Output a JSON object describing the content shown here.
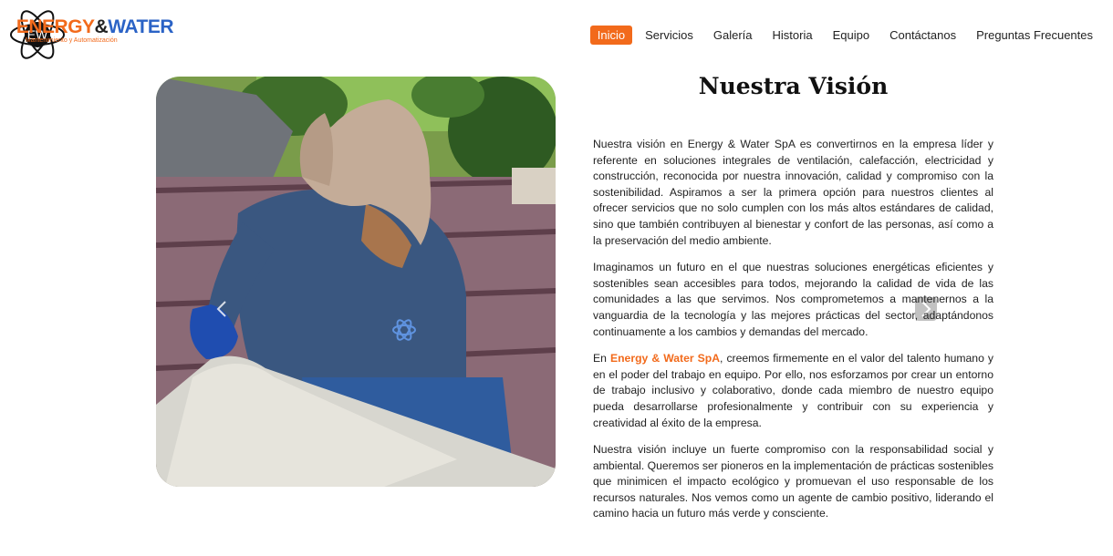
{
  "logo": {
    "mark_text": "EW",
    "word_energy": "ENERGY",
    "word_amp": "&",
    "word_water": "WATER",
    "tagline": "Mantenimiento y Automatización",
    "colors": {
      "orange": "#f26a1b",
      "blue": "#2b63c6"
    }
  },
  "nav": {
    "items": [
      {
        "label": "Inicio",
        "active": true
      },
      {
        "label": "Servicios"
      },
      {
        "label": "Galería"
      },
      {
        "label": "Historia"
      },
      {
        "label": "Equipo"
      },
      {
        "label": "Contáctanos"
      },
      {
        "label": "Preguntas Frecuentes"
      }
    ]
  },
  "carousel": {
    "prev_icon": "chevron-left-icon",
    "next_icon": "chevron-right-icon"
  },
  "vision": {
    "title": "Nuestra Visión",
    "p1": "Nuestra visión en Energy & Water SpA es convertirnos en la empresa líder y referente en soluciones integrales de ventilación, calefacción, electricidad y construcción, reconocida por nuestra innovación, calidad y compromiso con la sostenibilidad. Aspiramos a ser la primera opción para nuestros clientes al ofrecer servicios que no solo cumplen con los más altos estándares de calidad, sino que también contribuyen al bienestar y confort de las personas, así como a la preservación del medio ambiente.",
    "p2": "Imaginamos un futuro en el que nuestras soluciones energéticas eficientes y sostenibles sean accesibles para todos, mejorando la calidad de vida de las comunidades a las que servimos. Nos comprometemos a mantenernos a la vanguardia de la tecnología y las mejores prácticas del sector, adaptándonos continuamente a los cambios y demandas del mercado.",
    "p3_prefix": "En ",
    "p3_brand": "Energy & Water SpA",
    "p3_rest": ", creemos firmemente en el valor del talento humano y en el poder del trabajo en equipo. Por ello, nos esforzamos por crear un entorno de trabajo inclusivo y colaborativo, donde cada miembro de nuestro equipo pueda desarrollarse profesionalmente y contribuir con su experiencia y creatividad al éxito de la empresa.",
    "p4": "Nuestra visión incluye un fuerte compromiso con la responsabilidad social y ambiental. Queremos ser pioneros en la implementación de prácticas sostenibles que minimicen el impacto ecológico y promuevan el uso responsable de los recursos naturales. Nos vemos como un agente de cambio positivo, liderando el camino hacia un futuro más verde y consciente."
  }
}
